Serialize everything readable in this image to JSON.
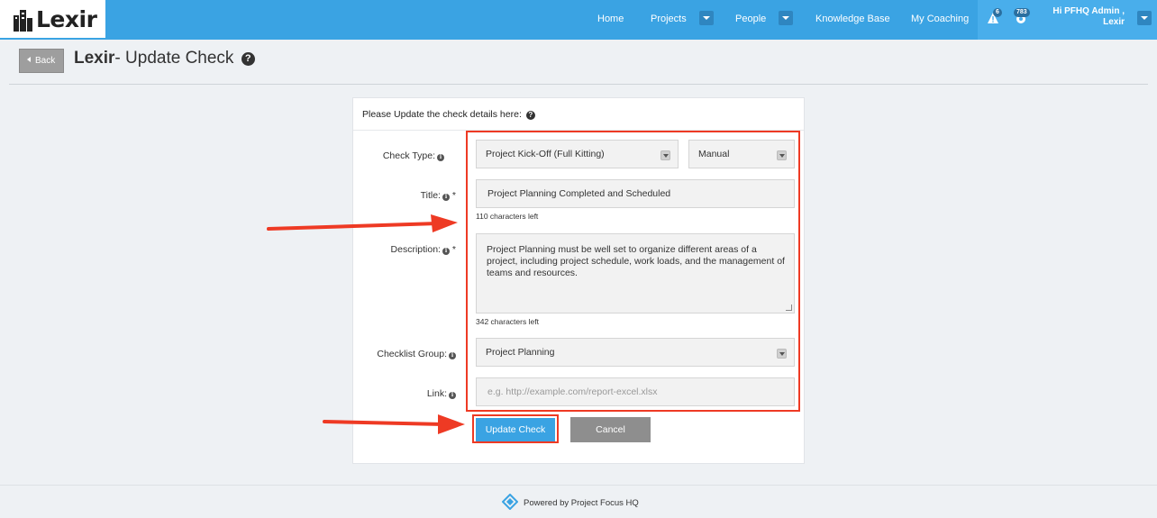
{
  "brand": {
    "name": "Lexir"
  },
  "nav": {
    "items": [
      {
        "label": "Home"
      },
      {
        "label": "Projects"
      },
      {
        "label": "People"
      },
      {
        "label": "Knowledge Base"
      },
      {
        "label": "My Coaching"
      }
    ],
    "alerts_count": "6",
    "notifications_count": "783",
    "user_greeting_line1": "Hi PFHQ Admin ,",
    "user_greeting_line2": "Lexir"
  },
  "header": {
    "back_label": "Back",
    "title_bold": "Lexir",
    "title_rest": "- Update Check"
  },
  "form": {
    "heading": "Please Update the check details here:",
    "check_type_label": "Check Type:",
    "check_type_value": "Project Kick-Off (Full Kitting)",
    "check_mode_value": "Manual",
    "title_label": "Title:",
    "title_value": "Project Planning Completed and Scheduled",
    "title_chars_left": "110 characters left",
    "description_label": "Description:",
    "description_value": "Project Planning must be well set to organize different areas of a project, including project schedule, work loads, and the management of teams and resources.",
    "description_chars_left": "342 characters left",
    "checklist_group_label": "Checklist Group:",
    "checklist_group_value": "Project Planning",
    "link_label": "Link:",
    "link_placeholder": "e.g. http://example.com/report-excel.xlsx",
    "required_mark": "*",
    "update_button": "Update Check",
    "cancel_button": "Cancel"
  },
  "footer": {
    "text": "Powered by Project Focus HQ"
  },
  "colors": {
    "primary": "#3aa3e3",
    "annotation": "#ee3a24",
    "cancel": "#8e8e8e"
  }
}
